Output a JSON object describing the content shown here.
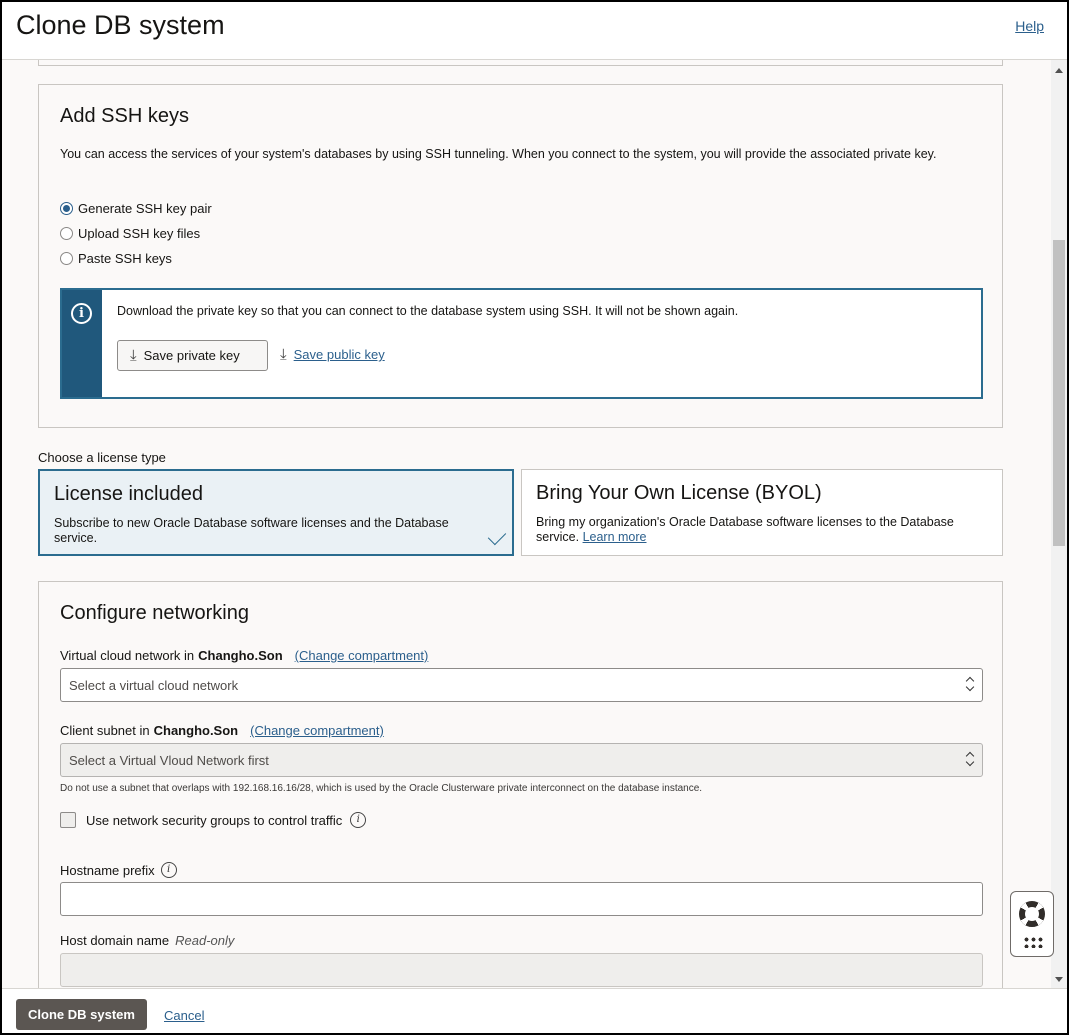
{
  "header": {
    "title": "Clone DB system",
    "help_label": "Help"
  },
  "ssh": {
    "title": "Add SSH keys",
    "description": "You can access the services of your system's databases by using SSH tunneling. When you connect to the system, you will provide the associated private key.",
    "options": [
      {
        "label": "Generate SSH key pair",
        "selected": true
      },
      {
        "label": "Upload SSH key files",
        "selected": false
      },
      {
        "label": "Paste SSH keys",
        "selected": false
      }
    ],
    "notice_text": "Download the private key so that you can connect to the database system using SSH. It will not be shown again.",
    "save_private_label": "Save private key",
    "save_public_label": "Save public key"
  },
  "license": {
    "label": "Choose a license type",
    "options": [
      {
        "title": "License included",
        "description": "Subscribe to new Oracle Database software licenses and the Database service.",
        "selected": true
      },
      {
        "title": "Bring Your Own License (BYOL)",
        "description": "Bring my organization's Oracle Database software licenses to the Database service.",
        "link": "Learn more",
        "selected": false
      }
    ]
  },
  "networking": {
    "title": "Configure networking",
    "vcn_label": "Virtual cloud network in",
    "vcn_compartment": "Changho.Son",
    "change_compartment": "(Change compartment)",
    "vcn_placeholder": "Select a virtual cloud network",
    "subnet_label": "Client subnet in",
    "subnet_compartment": "Changho.Son",
    "subnet_placeholder": "Select a Virtual Vloud Network first",
    "subnet_hint": "Do not use a subnet that overlaps with 192.168.16.16/28, which is used by the Oracle Clusterware private interconnect on the database instance.",
    "nsg_label": "Use network security groups to control traffic",
    "hostname_label": "Hostname prefix",
    "hostname_value": "",
    "domain_label": "Host domain name",
    "domain_readonly": "Read-only",
    "domain_value": ""
  },
  "footer": {
    "primary_label": "Clone DB system",
    "cancel_label": "Cancel"
  },
  "colors": {
    "accent": "#2b5f8c",
    "notice_bar": "#20587c",
    "primary_button": "#5b5652"
  }
}
